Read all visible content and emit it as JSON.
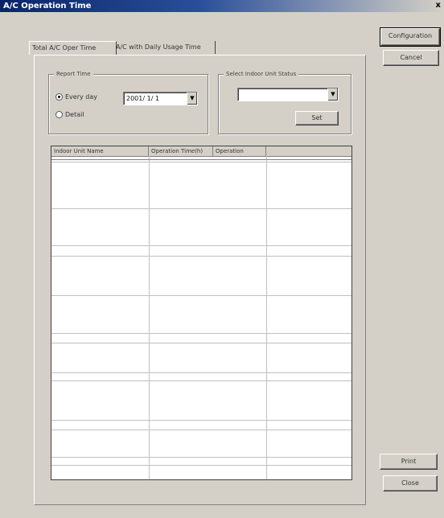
{
  "window": {
    "title": "A/C Operation Time",
    "close_label": "x"
  },
  "buttons": {
    "top": "Configuration",
    "cancel": "Cancel",
    "print": "Print",
    "close": "Close"
  },
  "tabs": [
    {
      "label": "Total A/C Oper Time",
      "active": true
    },
    {
      "label": "A/C with Daily Usage Time",
      "active": false
    }
  ],
  "report_group": {
    "legend": "Report Time",
    "option1": "Every day",
    "option2": "Detail",
    "date_value": "2001/ 1/ 1"
  },
  "unit_group": {
    "legend": "Select Indoor Unit Status",
    "combo_value": "",
    "set_button": "Set"
  },
  "table": {
    "columns": [
      "Indoor Unit Name",
      "Operation Time(h)",
      "Operation"
    ],
    "rows": []
  }
}
